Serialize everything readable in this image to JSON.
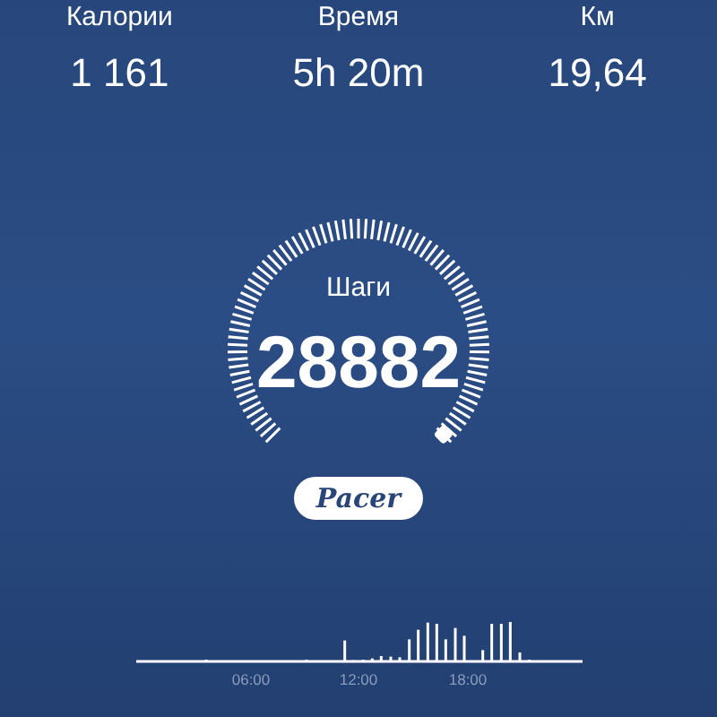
{
  "stats": [
    {
      "label": "Калории",
      "value": "1 161"
    },
    {
      "label": "Время",
      "value": "5h 20m"
    },
    {
      "label": "Км",
      "value": "19,64"
    }
  ],
  "steps": {
    "label": "Шаги",
    "value": "28882"
  },
  "logo": {
    "text": "Pacer"
  },
  "activity": {
    "time_labels": [
      "06:00",
      "12:00",
      "18:00"
    ]
  }
}
